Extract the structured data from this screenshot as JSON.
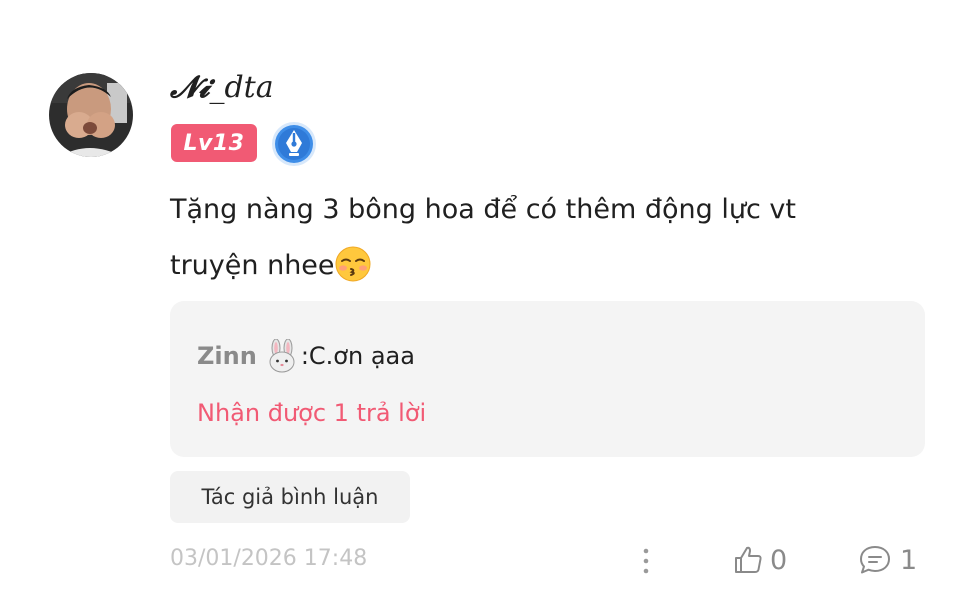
{
  "comment": {
    "username_fancy": "𝓝𝓲",
    "username_rest": "_dta",
    "level": "Lv13",
    "text_line1": "Tặng nàng 3 bông hoa để có thêm động lực vt",
    "text_line2": "truyện nhee",
    "emoji": "kissing-face-with-closed-eyes",
    "reply": {
      "author": "Zinn",
      "author_emoji": "rabbit-face",
      "separator": ": ",
      "text": "C.ơn ạaa",
      "count_text": "Nhận được 1 trả lời"
    },
    "author_tag": "Tác giả bình luận",
    "timestamp": "03/01/2026 17:48",
    "likes": "0",
    "replies": "1"
  },
  "colors": {
    "accent": "#f15a74",
    "badge_blue": "#3f8ee8",
    "muted": "#8a8a8a",
    "reply_bg": "#f4f4f4"
  },
  "icons": {
    "more": "more-vertical-icon",
    "like": "thumbs-up-icon",
    "reply": "comment-bubble-icon",
    "badge": "pen-nib-badge-icon"
  }
}
